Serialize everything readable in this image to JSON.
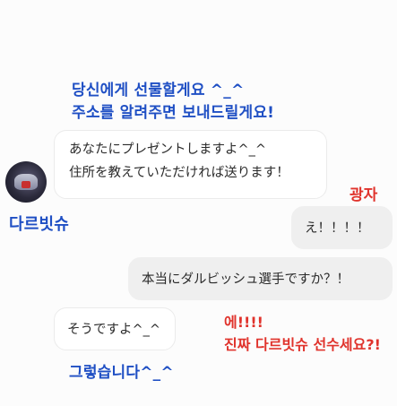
{
  "captions": {
    "top_line1": "당신에게 선물할게요 ^_^",
    "top_line2": "주소를 알려주면 보내드릴게요!",
    "left_name": "다르빗슈",
    "right_name": "광자",
    "bottom_left": "그렇습니다^_^",
    "bottom_right_line1": "에!!!!",
    "bottom_right_line2": "진짜 다르빗슈 선수세요?!"
  },
  "messages": {
    "msg1_line1": "あなたにプレゼントしますよ^_^",
    "msg1_line2": "住所を教えていただければ送ります！",
    "msg2": "え！！！！",
    "msg3": "本当にダルビッシュ選手ですか？！",
    "msg4": "そうですよ^_^"
  },
  "colors": {
    "caption_blue": "#1f4fc4",
    "caption_red": "#e0332c",
    "bubble_gray": "#efefef",
    "bubble_white": "#ffffff"
  }
}
